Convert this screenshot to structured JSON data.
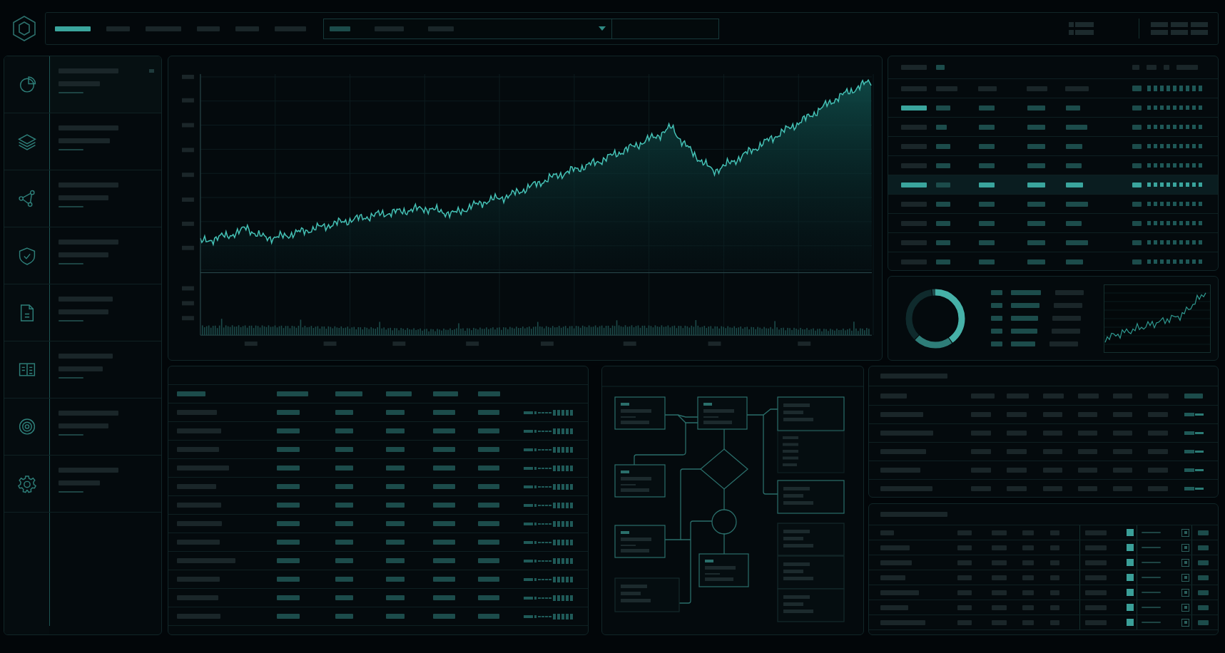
{
  "top_nav": {
    "tabs": [
      {
        "selected": true
      },
      {
        "selected": false
      },
      {
        "selected": false
      },
      {
        "selected": false
      },
      {
        "selected": false
      },
      {
        "selected": false
      }
    ]
  },
  "filter": {
    "segments": [
      {
        "selected": true
      },
      {
        "selected": false
      },
      {
        "selected": false
      }
    ]
  },
  "sidebar": {
    "items": [
      {
        "selected": true
      },
      {
        "selected": false
      },
      {
        "selected": false
      },
      {
        "selected": false
      },
      {
        "selected": false
      },
      {
        "selected": false
      },
      {
        "selected": false
      },
      {
        "selected": false
      }
    ]
  },
  "ranking_table": {
    "rows": [
      {
        "selected": false,
        "flagged": true
      },
      {
        "selected": false,
        "flagged": false
      },
      {
        "selected": false,
        "flagged": false
      },
      {
        "selected": false,
        "flagged": false
      },
      {
        "selected": true,
        "flagged": false
      },
      {
        "selected": false,
        "flagged": false
      },
      {
        "selected": false,
        "flagged": false
      },
      {
        "selected": false,
        "flagged": false
      },
      {
        "selected": false,
        "flagged": false
      }
    ]
  },
  "task_table": {
    "rows": [
      {
        "checked": true
      },
      {
        "checked": true
      },
      {
        "checked": true
      },
      {
        "checked": true
      },
      {
        "checked": true
      },
      {
        "checked": true
      },
      {
        "checked": true
      }
    ]
  }
}
